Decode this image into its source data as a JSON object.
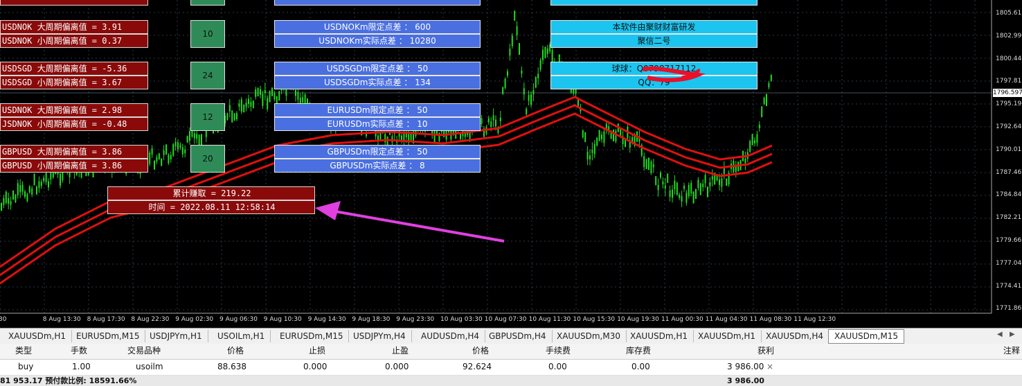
{
  "chart": {
    "price_labels": [
      "1805.615",
      "1802.990",
      "1800.440",
      "1797.815",
      "1795.190",
      "1792.640",
      "1790.015",
      "1787.465",
      "1784.840",
      "1782.215",
      "1779.665",
      "1777.040",
      "1774.415",
      "1771.865"
    ],
    "current_price": "1796.597",
    "time_labels": [
      "30",
      "8 Aug 13:30",
      "8 Aug 17:30",
      "8 Aug 22:30",
      "9 Aug 02:30",
      "9 Aug 06:30",
      "9 Aug 10:30",
      "9 Aug 14:30",
      "9 Aug 18:30",
      "9 Aug 23:30",
      "10 Aug 03:30",
      "10 Aug 07:30",
      "10 Aug 11:30",
      "10 Aug 15:30",
      "10 Aug 19:30",
      "11 Aug 00:30",
      "11 Aug 04:30",
      "11 Aug 08:30",
      "11 Aug 12:30"
    ],
    "colors": {
      "candle": "#22dd22",
      "ma": "#e01010",
      "arrow": "#e040e0",
      "grid": "#2a3a4a"
    }
  },
  "deviation": [
    {
      "big": "USDNOK 大周期偏离值 = 3.91",
      "small": "USDNOK 小周期偏离值 = 0.37",
      "count": "10"
    },
    {
      "big": "USDSGD 大周期偏离值 = -5.36",
      "small": "USDSGD 小周期偏离值 = 3.67",
      "count": "24"
    },
    {
      "big": "USDNOK 大周期偏离值 = 2.98",
      "small": "JSDNOK 小周期偏离值 = -0.48",
      "count": "12"
    },
    {
      "big": "GBPUSD 大周期偏离值 = 3.86",
      "small": "GBPUSD 小周期偏离值 = 3.86",
      "count": "20"
    }
  ],
  "spreads": [
    {
      "limit": "USDNOKm限定点差      ： 600",
      "actual": "USDNOKm实际点差      ： 10280"
    },
    {
      "limit": "USDSGDm限定点差      ： 50",
      "actual": "USDSGDm实际点差      ： 134"
    },
    {
      "limit": "EURUSDm限定点差      ： 50",
      "actual": "EURUSDm实际点差      ： 10"
    },
    {
      "limit": "GBPUSDm限定点差      ： 50",
      "actual": "GBPUSDm实际点差      ： 8"
    }
  ],
  "info": {
    "line1": "本软件由聚财财富研发",
    "line2": "聚信二号",
    "line3": "球球：Q0798717112",
    "line4": "QQ：79"
  },
  "profit": {
    "cumulative": "累计赚取            = 219.22",
    "time": "时间 = 2022.08.11     12:58:14"
  },
  "tabs": [
    "XAUUSDm,H1",
    "EURUSDm,M15",
    "USDJPYm,H1",
    "USOILm,H1",
    "EURUSDm,M15",
    "USDJPYm,H4",
    "AUDUSDm,H4",
    "GBPUSDm,H4",
    "XAUUSDm,M30",
    "XAUUSDm,H1",
    "XAUUSDm,H1",
    "XAUUSDm,H4",
    "XAUUSDm,M15"
  ],
  "table": {
    "headers": {
      "type": "类型",
      "lots": "手数",
      "symbol": "交易品种",
      "price": "价格",
      "sl": "止损",
      "tp": "止盈",
      "price2": "价格",
      "commission": "手续费",
      "swap": "库存费",
      "profit": "获利",
      "comment": "注释"
    },
    "row": {
      "type": "buy",
      "lots": "1.00",
      "symbol": "usoilm",
      "price": "88.638",
      "sl": "0.000",
      "tp": "0.000",
      "price2": "92.624",
      "commission": "0.00",
      "swap": "0.00",
      "profit": "3 986.00",
      "close": "×"
    },
    "summary": {
      "left": "81 953.17  预付款比例: 18591.66%",
      "profit": "3 986.00"
    }
  }
}
